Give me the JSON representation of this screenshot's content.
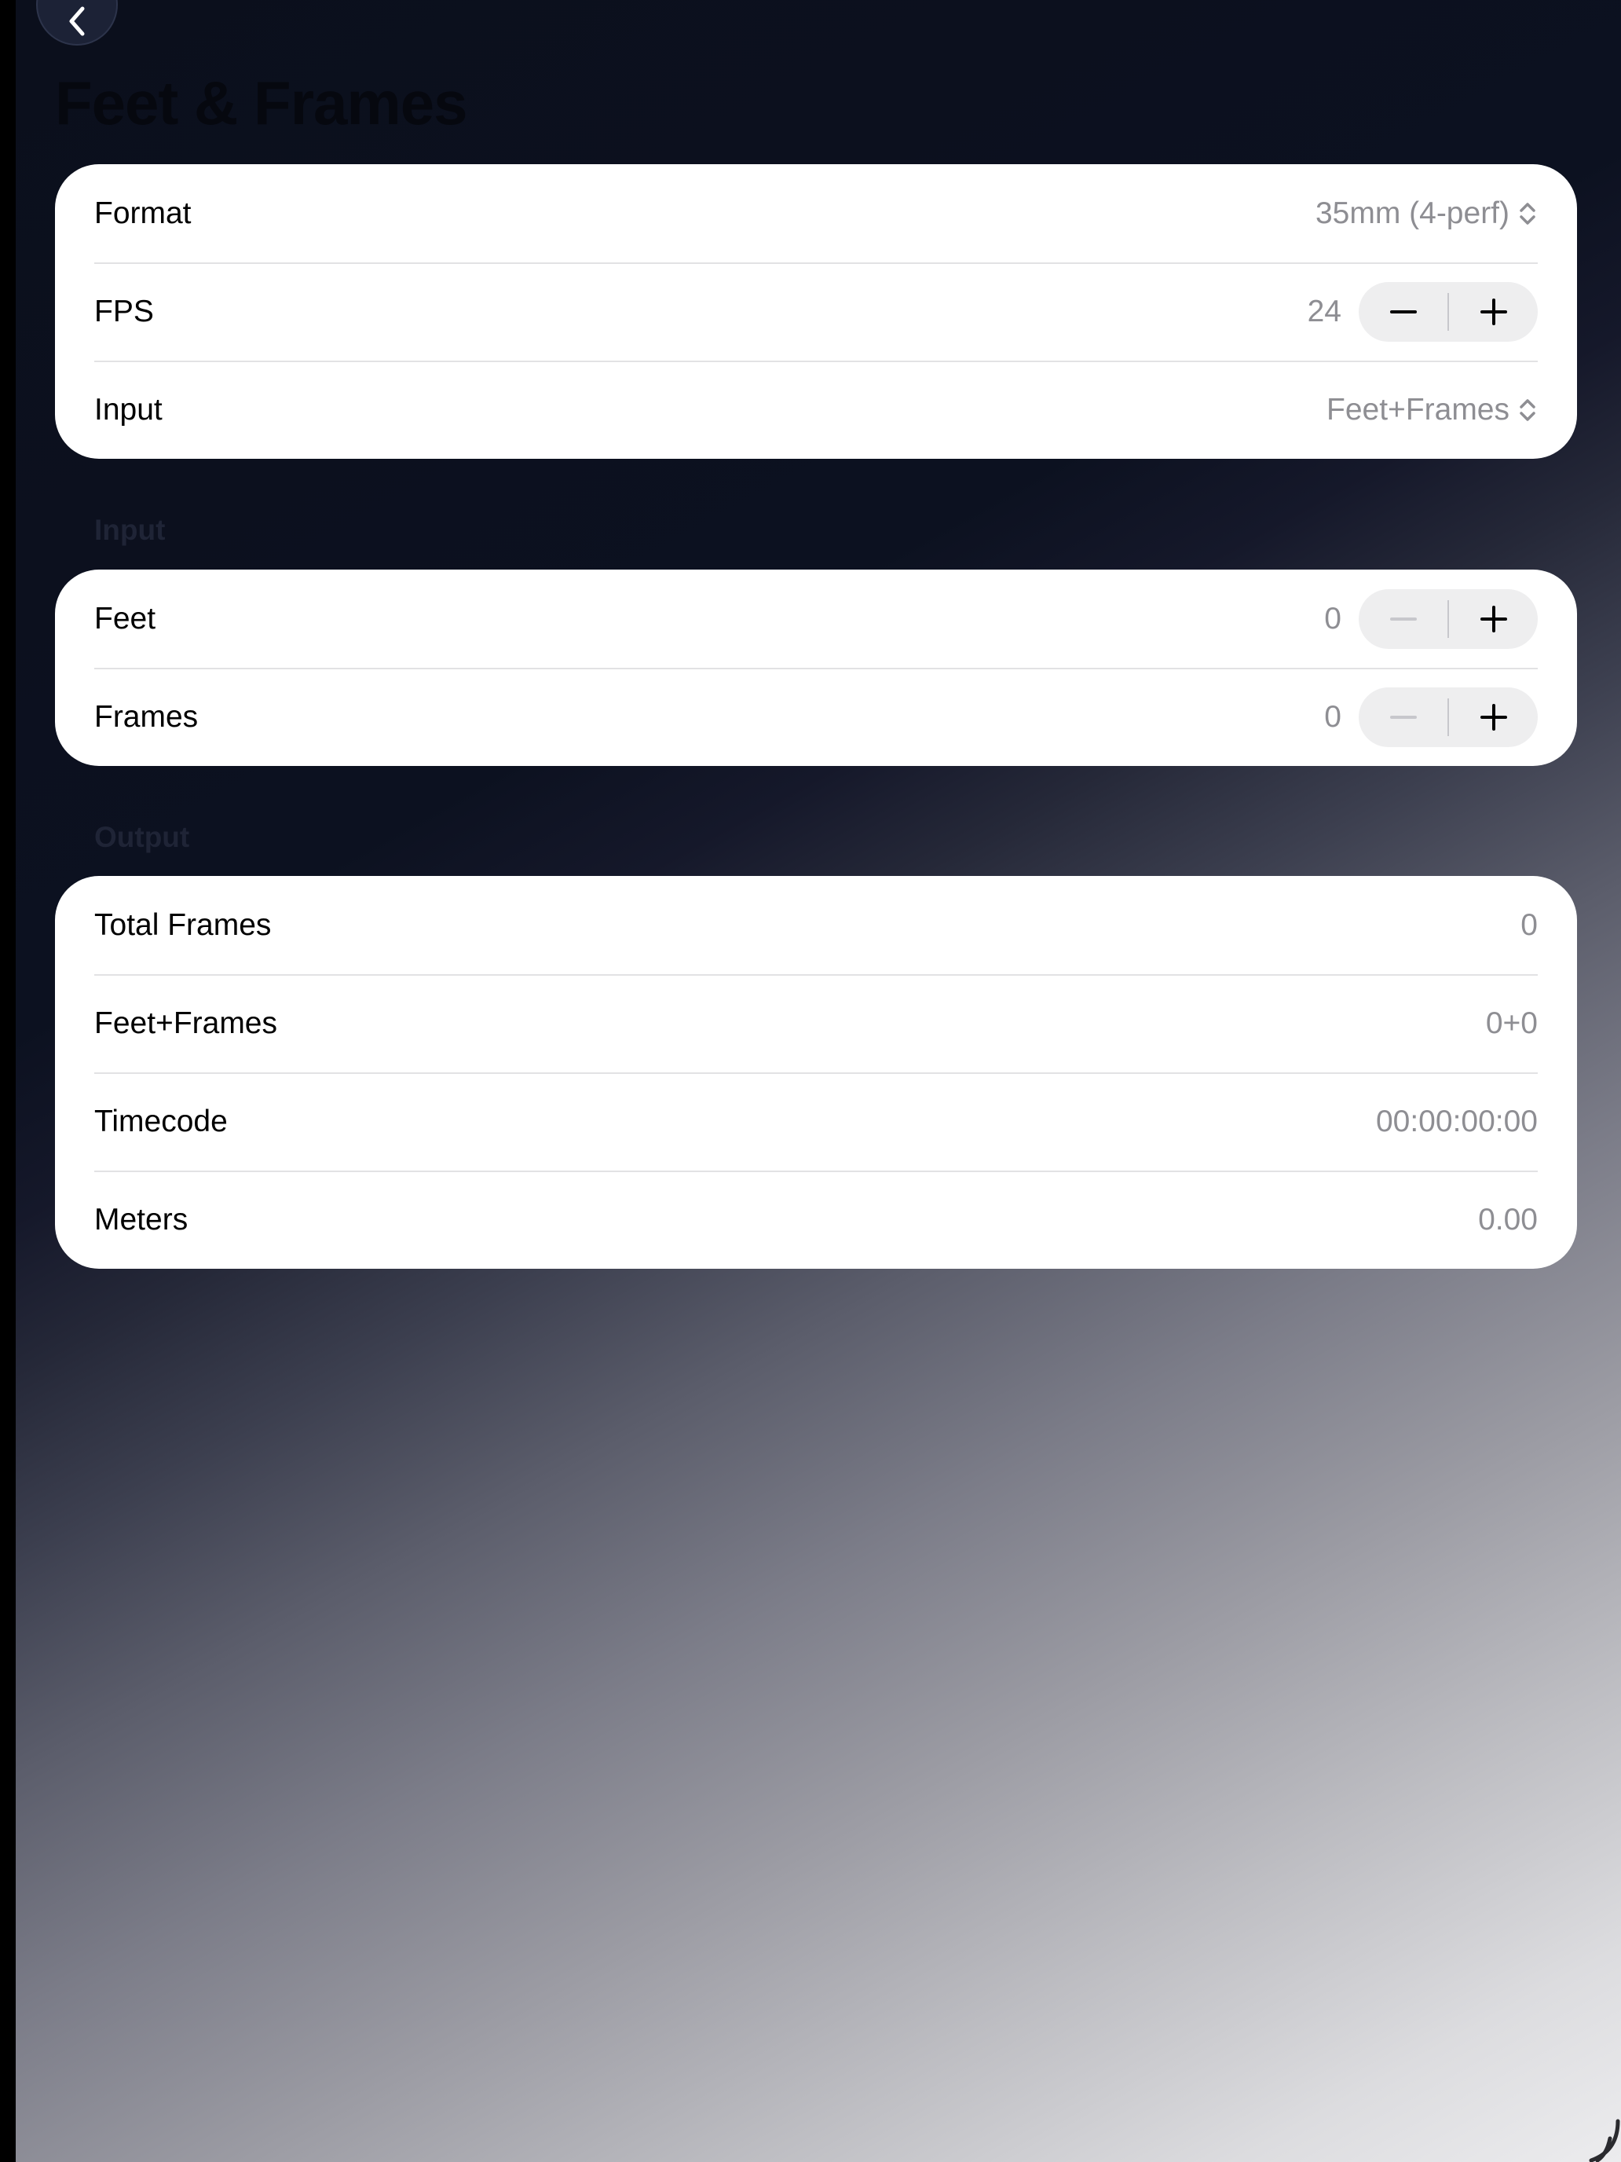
{
  "nav": {
    "back_icon": "chevron-left-icon",
    "title": "Feet & Frames"
  },
  "settings": {
    "format_label": "Format",
    "format_value": "35mm (4-perf)",
    "fps_label": "FPS",
    "fps_value": "24",
    "input_label": "Input",
    "input_value": "Feet+Frames"
  },
  "input_section": {
    "header": "Input",
    "feet_label": "Feet",
    "feet_value": "0",
    "frames_label": "Frames",
    "frames_value": "0"
  },
  "output_section": {
    "header": "Output",
    "total_frames_label": "Total Frames",
    "total_frames_value": "0",
    "feet_frames_label": "Feet+Frames",
    "feet_frames_value": "0+0",
    "timecode_label": "Timecode",
    "timecode_value": "00:00:00:00",
    "meters_label": "Meters",
    "meters_value": "0.00"
  },
  "icons": {
    "picker": "chevron-up-down-icon",
    "decrement": "minus-icon",
    "increment": "plus-icon"
  },
  "colors": {
    "card_background": "#ffffff",
    "secondary_text": "#8e8e93",
    "stepper_background": "#eeeeef"
  }
}
